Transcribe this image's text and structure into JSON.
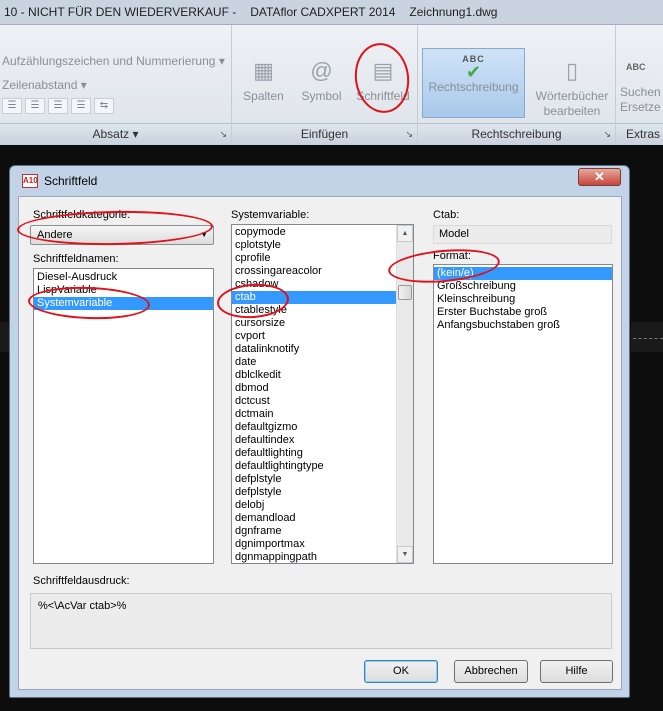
{
  "titlebar": {
    "version": "10 - NICHT FÜR DEN WIEDERVERKAUF -",
    "product": "DATAflor CADXPERT 2014",
    "document": "Zeichnung1.dwg"
  },
  "ribbon": {
    "absatz": {
      "bullets_label": "Aufzählungszeichen und Nummerierung",
      "bullets_arrow": "▾",
      "linespacing_label": "Zeilenabstand",
      "linespacing_arrow": "▾",
      "panel_title": "Absatz",
      "panel_arrow": "▾",
      "corner": "↘"
    },
    "einfuegen": {
      "spalten": "Spalten",
      "symbol": "Symbol",
      "schriftfeld": "Schriftfeld",
      "panel_title": "Einfügen",
      "corner": "↘"
    },
    "rechtschreibung": {
      "abc": "ABC",
      "rechtschreibung": "Rechtschreibung",
      "woerterbuecher_line1": "Wörterbücher",
      "woerterbuecher_line2": "bearbeiten",
      "panel_title": "Rechtschreibung",
      "corner": "↘"
    },
    "extras": {
      "abc": "ABC",
      "suchen_line1": "Suchen",
      "suchen_line2": "Ersetze",
      "panel_title": "Extras"
    }
  },
  "dialog": {
    "title": "Schriftfeld",
    "app_icon_text": "A10",
    "close_glyph": "✕",
    "kategorie_label": "Schriftfeldkategorie:",
    "kategorie_value": "Andere",
    "names_label": "Schriftfeldnamen:",
    "names": [
      {
        "text": "Diesel-Ausdruck",
        "selected": false
      },
      {
        "text": "LispVariable",
        "selected": false
      },
      {
        "text": "Systemvariable",
        "selected": true
      }
    ],
    "sysvar_label": "Systemvariable:",
    "sysvars": [
      {
        "text": "copymode",
        "selected": false
      },
      {
        "text": "cplotstyle",
        "selected": false
      },
      {
        "text": "cprofile",
        "selected": false
      },
      {
        "text": "crossingareacolor",
        "selected": false
      },
      {
        "text": "cshadow",
        "selected": false
      },
      {
        "text": "ctab",
        "selected": true
      },
      {
        "text": "ctablestyle",
        "selected": false
      },
      {
        "text": "cursorsize",
        "selected": false
      },
      {
        "text": "cvport",
        "selected": false
      },
      {
        "text": "datalinknotify",
        "selected": false
      },
      {
        "text": "date",
        "selected": false
      },
      {
        "text": "dblclkedit",
        "selected": false
      },
      {
        "text": "dbmod",
        "selected": false
      },
      {
        "text": "dctcust",
        "selected": false
      },
      {
        "text": "dctmain",
        "selected": false
      },
      {
        "text": "defaultgizmo",
        "selected": false
      },
      {
        "text": "defaultindex",
        "selected": false
      },
      {
        "text": "defaultlighting",
        "selected": false
      },
      {
        "text": "defaultlightingtype",
        "selected": false
      },
      {
        "text": "defplstyle",
        "selected": false
      },
      {
        "text": "defplstyle",
        "selected": false
      },
      {
        "text": "delobj",
        "selected": false
      },
      {
        "text": "demandload",
        "selected": false
      },
      {
        "text": "dgnframe",
        "selected": false
      },
      {
        "text": "dgnimportmax",
        "selected": false
      },
      {
        "text": "dgnmappingpath",
        "selected": false
      }
    ],
    "ctab_label": "Ctab:",
    "ctab_value": "Model",
    "format_label": "Format:",
    "formats": [
      {
        "text": "(kein/e)",
        "selected": true
      },
      {
        "text": "Großschreibung",
        "selected": false
      },
      {
        "text": "Kleinschreibung",
        "selected": false
      },
      {
        "text": "Erster Buchstabe groß",
        "selected": false
      },
      {
        "text": "Anfangsbuchstaben groß",
        "selected": false
      }
    ],
    "expr_label": "Schriftfeldausdruck:",
    "expr_value": "%<\\AcVar ctab>%",
    "buttons": {
      "ok": "OK",
      "cancel": "Abbrechen",
      "help": "Hilfe"
    }
  }
}
